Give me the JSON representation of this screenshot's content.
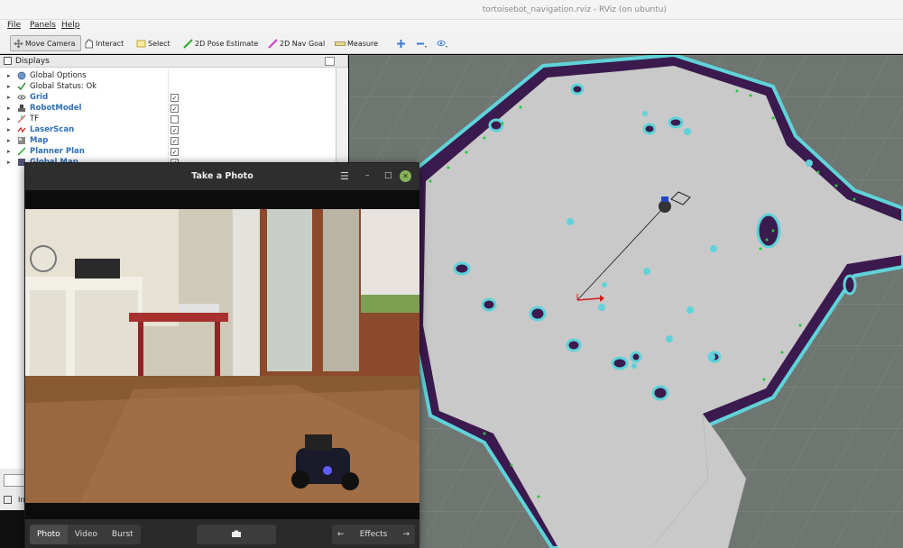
{
  "window": {
    "title": "tortoisebot_navigation.rviz - RViz (on ubuntu)"
  },
  "menu": {
    "file": "File",
    "panels": "Panels",
    "help": "Help"
  },
  "toolbar": {
    "move_camera": "Move Camera",
    "interact": "Interact",
    "select": "Select",
    "pose_estimate": "2D Pose Estimate",
    "nav_goal": "2D Nav Goal",
    "measure": "Measure",
    "icons": [
      "plus-icon",
      "minus-icon",
      "eye-icon"
    ]
  },
  "displays": {
    "title": "Displays",
    "items": [
      {
        "label": "Global Options",
        "icon": "globe-icon",
        "checked": null,
        "blue": false
      },
      {
        "label": "Global Status: Ok",
        "icon": "check-icon",
        "checked": null,
        "blue": false
      },
      {
        "label": "Grid",
        "icon": "grid-icon",
        "checked": true,
        "blue": true
      },
      {
        "label": "RobotModel",
        "icon": "robot-icon",
        "checked": true,
        "blue": true
      },
      {
        "label": "TF",
        "icon": "tf-icon",
        "checked": false,
        "blue": false
      },
      {
        "label": "LaserScan",
        "icon": "laser-icon",
        "checked": true,
        "blue": true
      },
      {
        "label": "Map",
        "icon": "map-icon",
        "checked": true,
        "blue": true
      },
      {
        "label": "Planner Plan",
        "icon": "path-icon",
        "checked": true,
        "blue": true
      },
      {
        "label": "Global Map",
        "icon": "map-icon",
        "checked": true,
        "blue": true
      }
    ]
  },
  "lower_panel": {
    "label": "In"
  },
  "photo": {
    "title": "Take a Photo",
    "modes": [
      "Photo",
      "Video",
      "Burst"
    ],
    "selected_mode": "Photo",
    "effects": "Effects"
  },
  "colors": {
    "map_free": "#c9c9c9",
    "map_wall": "#3b1a4e",
    "inflation": "#5fd3d9",
    "laser": "#22c93a"
  }
}
